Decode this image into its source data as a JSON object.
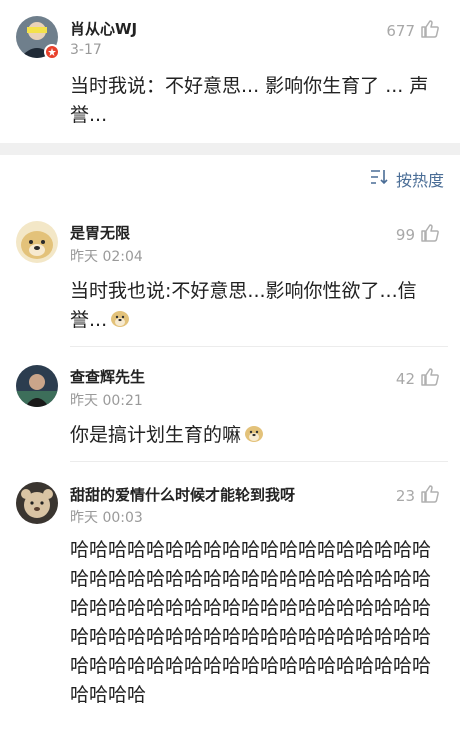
{
  "pinned_comment": {
    "username": "肖从心WJ",
    "time": "3-17",
    "likes": "677",
    "text": "当时我说：不好意思... 影响你生育了 ... 声誉..."
  },
  "sort": {
    "label": "按热度"
  },
  "comments": [
    {
      "username": "是胃无限",
      "time": "昨天 02:04",
      "likes": "99",
      "text": "当时我也说:不好意思...影响你性欲了...信誉..."
    },
    {
      "username": "查查辉先生",
      "time": "昨天 00:21",
      "likes": "42",
      "text": "你是搞计划生育的嘛"
    },
    {
      "username": "甜甜的爱情什么时候才能轮到我呀",
      "time": "昨天 00:03",
      "likes": "23",
      "text": "哈哈哈哈哈哈哈哈哈哈哈哈哈哈哈哈哈哈哈哈哈哈哈哈哈哈哈哈哈哈哈哈哈哈哈哈哈哈哈哈哈哈哈哈哈哈哈哈哈哈哈哈哈哈哈哈哈哈哈哈哈哈哈哈哈哈哈哈哈哈哈哈哈哈哈哈哈哈哈哈哈哈哈哈哈哈哈哈哈哈哈哈哈哈哈哈哈哈哈"
    }
  ],
  "icons": {
    "like": "thumbs-up-icon",
    "sort": "sort-icon",
    "doge": "doge-emoji-icon",
    "verified": "verified-badge-icon"
  },
  "colors": {
    "link": "#4a6d96",
    "meta": "#9a9a9a",
    "verified": "#e8412c"
  }
}
